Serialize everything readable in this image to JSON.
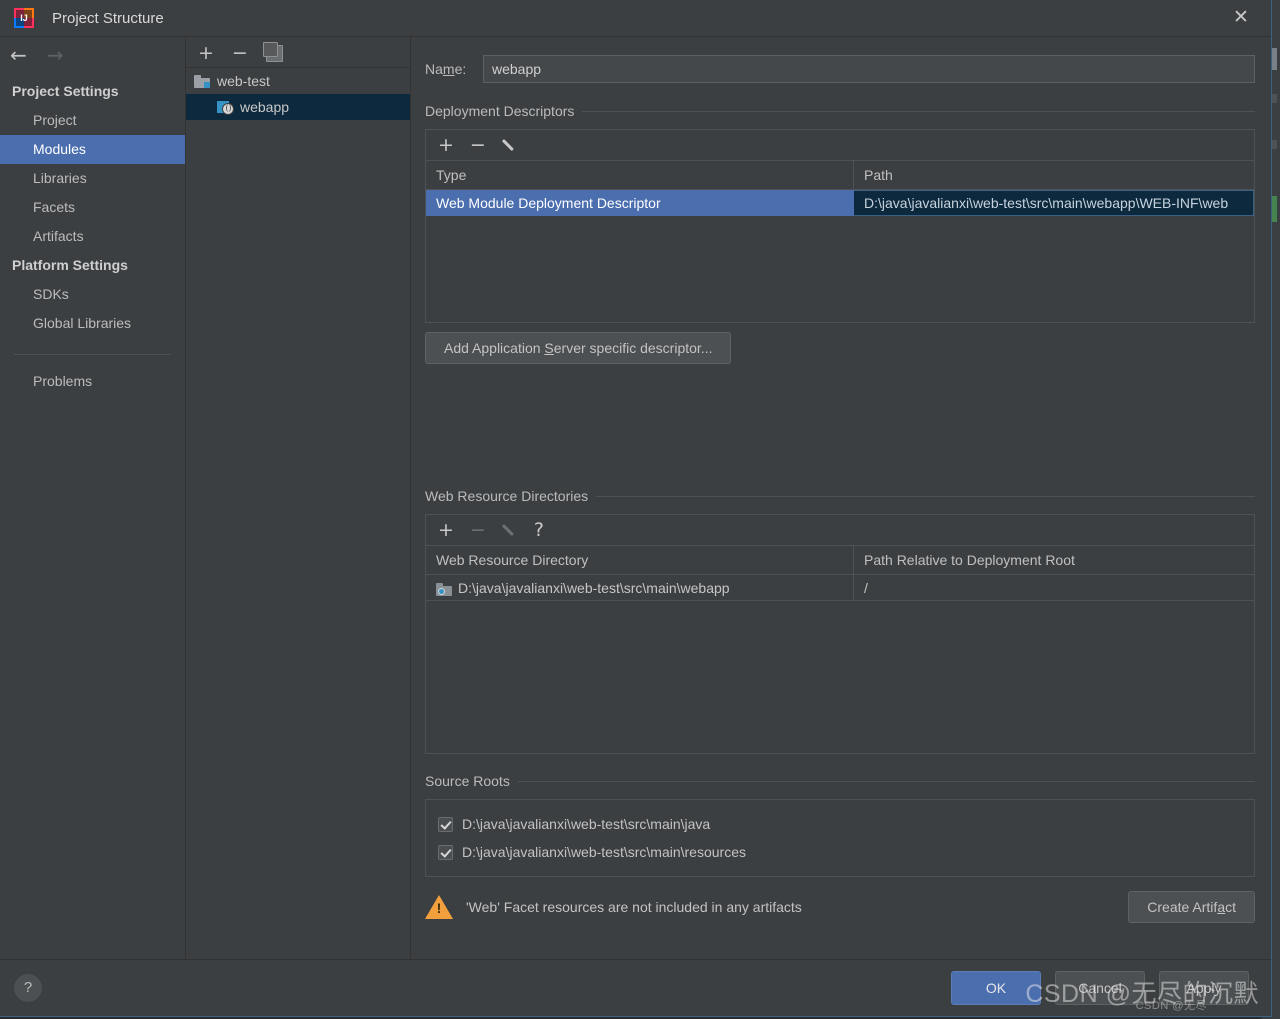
{
  "window": {
    "title": "Project Structure",
    "logo_text": "IJ",
    "close_icon": "✕"
  },
  "nav": {
    "back_icon": "←",
    "forward_icon": "→",
    "groups": [
      {
        "label": "Project Settings",
        "items": [
          {
            "label": "Project",
            "selected": false
          },
          {
            "label": "Modules",
            "selected": true
          },
          {
            "label": "Libraries",
            "selected": false
          },
          {
            "label": "Facets",
            "selected": false
          },
          {
            "label": "Artifacts",
            "selected": false
          }
        ]
      },
      {
        "label": "Platform Settings",
        "items": [
          {
            "label": "SDKs",
            "selected": false
          },
          {
            "label": "Global Libraries",
            "selected": false
          }
        ]
      }
    ],
    "extra_items": [
      {
        "label": "Problems",
        "selected": false
      }
    ]
  },
  "module_tree": {
    "toolbar": {
      "add_icon": "+",
      "remove_icon": "−",
      "copy_icon": "copy-icon"
    },
    "rows": [
      {
        "label": "web-test",
        "icon": "folder-icon",
        "level": 0,
        "selected": false
      },
      {
        "label": "webapp",
        "icon": "web-module-icon",
        "level": 1,
        "selected": true
      }
    ]
  },
  "name_field": {
    "label_before": "Na",
    "label_mnemonic": "m",
    "label_after": "e:",
    "value": "webapp"
  },
  "deployment_descriptors": {
    "section_title": "Deployment Descriptors",
    "toolbar": {
      "add_icon": "+",
      "remove_icon": "−",
      "edit_icon": "pencil-icon"
    },
    "columns": [
      "Type",
      "Path"
    ],
    "rows": [
      {
        "type": "Web Module Deployment Descriptor",
        "path": "D:\\java\\javalianxi\\web-test\\src\\main\\webapp\\WEB-INF\\web",
        "selected": true
      }
    ],
    "add_server_button": {
      "text_before": "Add Application ",
      "mnemonic": "S",
      "text_after": "erver specific descriptor..."
    }
  },
  "web_resource_directories": {
    "section_title": "Web Resource Directories",
    "toolbar": {
      "add_icon": "+",
      "remove_icon": "−",
      "edit_icon": "pencil-icon",
      "help_icon": "?"
    },
    "columns": [
      "Web Resource Directory",
      "Path Relative to Deployment Root"
    ],
    "rows": [
      {
        "directory": "D:\\java\\javalianxi\\web-test\\src\\main\\webapp",
        "relative_path": "/",
        "icon": "web-directory-icon"
      }
    ]
  },
  "source_roots": {
    "section_title": "Source Roots",
    "items": [
      {
        "label": "D:\\java\\javalianxi\\web-test\\src\\main\\java",
        "checked": true
      },
      {
        "label": "D:\\java\\javalianxi\\web-test\\src\\main\\resources",
        "checked": true
      }
    ]
  },
  "warning": {
    "icon": "warning-triangle-icon",
    "message": "'Web' Facet resources are not included in any artifacts",
    "action_before": "Create Artif",
    "action_mnemonic": "a",
    "action_after": "ct"
  },
  "footer": {
    "help_icon": "?",
    "ok_label": "OK",
    "cancel_label": "Cancel",
    "apply_label": "Apply"
  },
  "watermark": {
    "main": "CSDN @无尽的沉默",
    "sub": "CSDN @无尽"
  }
}
